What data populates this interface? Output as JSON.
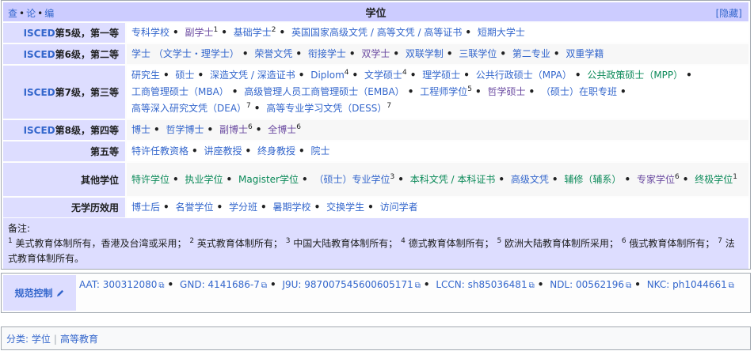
{
  "navbox": {
    "vde": [
      "查",
      "论",
      "编"
    ],
    "title": "学位",
    "hide_label": "[隐藏]",
    "rows": [
      {
        "group_prefix": "ISCED",
        "group_suffix": "第5级，第一等",
        "items": [
          {
            "text": "专科学校"
          },
          {
            "text": "副学士",
            "sup": "1"
          },
          {
            "text": "基础学士",
            "sup": "2"
          },
          {
            "text": "英国国家高级文凭 / 高等文凭 / 高等证书"
          },
          {
            "text": "短期大学士"
          }
        ]
      },
      {
        "group_prefix": "ISCED",
        "group_suffix": "第6级，第二等",
        "items": [
          {
            "text": "学士 （文学士・理学士）"
          },
          {
            "text": "荣誉文凭"
          },
          {
            "text": "衔接学士"
          },
          {
            "text": "双学士"
          },
          {
            "text": "双联学制"
          },
          {
            "text": "三联学位"
          },
          {
            "text": "第二专业"
          },
          {
            "text": "双重学籍"
          }
        ]
      },
      {
        "group_prefix": "ISCED",
        "group_suffix": "第7级，第三等",
        "items": [
          {
            "text": "研究生"
          },
          {
            "text": "硕士"
          },
          {
            "text": "深造文凭 / 深造证书"
          },
          {
            "text": "Diplom",
            "sup": "4"
          },
          {
            "text": "文学硕士",
            "sup": "4"
          },
          {
            "text": "理学硕士"
          },
          {
            "text": "公共行政硕士（MPA）"
          },
          {
            "text": "公共政策硕士（MPP）"
          },
          {
            "text": "工商管理硕士（MBA）"
          },
          {
            "text": "高级管理人员工商管理硕士（EMBA）"
          },
          {
            "text": "工程师学位",
            "sup": "5"
          },
          {
            "text": "哲学硕士"
          },
          {
            "text": "（硕士）在职专班"
          },
          {
            "text": "高等深入研究文凭（DEA）",
            "sup": "7"
          },
          {
            "text": "高等专业学习文凭（DESS）",
            "sup": "7"
          }
        ]
      },
      {
        "group_prefix": "ISCED",
        "group_suffix": "第8级，第四等",
        "items": [
          {
            "text": "博士"
          },
          {
            "text": "哲学博士"
          },
          {
            "text": "副博士",
            "sup": "6"
          },
          {
            "text": "全博士",
            "sup": "6"
          }
        ]
      },
      {
        "group_prefix": "",
        "group_suffix": "第五等",
        "items": [
          {
            "text": "特许任教资格"
          },
          {
            "text": "讲座教授"
          },
          {
            "text": "终身教授"
          },
          {
            "text": "院士"
          }
        ]
      },
      {
        "group_prefix": "",
        "group_suffix": "其他学位",
        "items": [
          {
            "text": "特许学位"
          },
          {
            "text": "执业学位"
          },
          {
            "text": "Magister学位"
          },
          {
            "text": "（硕士）专业学位",
            "sup": "3"
          },
          {
            "text": "本科文凭 / 本科证书"
          },
          {
            "text": "高级文凭"
          },
          {
            "text": "辅修（辅系）"
          },
          {
            "text": "专家学位",
            "sup": "6"
          },
          {
            "text": "终极学位",
            "sup": "1"
          }
        ]
      },
      {
        "group_prefix": "",
        "group_suffix": "无学历效用",
        "items": [
          {
            "text": "博士后"
          },
          {
            "text": "名誉学位"
          },
          {
            "text": "学分班"
          },
          {
            "text": "暑期学校"
          },
          {
            "text": "交换学生"
          },
          {
            "text": "访问学者"
          }
        ]
      }
    ],
    "note": {
      "label": "备注:",
      "lines": [
        {
          "sup": "1",
          "text": "美式教育体制所有，香港及台湾或采用；"
        },
        {
          "sup": "2",
          "text": "英式教育体制所有；"
        },
        {
          "sup": "3",
          "text": "中国大陆教育体制所有；"
        },
        {
          "sup": "4",
          "text": "德式教育体制所有；"
        },
        {
          "sup": "5",
          "text": "欧洲大陆教育体制所采用；"
        },
        {
          "sup": "6",
          "text": "俄式教育体制所有；"
        },
        {
          "sup": "7",
          "text": "法式教育体制所有。"
        }
      ]
    }
  },
  "authority": {
    "label": "规范控制",
    "items": [
      "AAT: 300312080",
      "GND: 4141686-7",
      "J9U: 987007545600605171",
      "LCCN: sh85036481",
      "NDL: 00562196",
      "NKC: ph1044661"
    ]
  },
  "categories": {
    "label": "分类:",
    "items": [
      "学位",
      "高等教育"
    ]
  },
  "colors": {
    "link": "#3366cc",
    "visited": "#6b4ba1",
    "title_bg": "#ccccff",
    "group_bg": "#ddddff"
  }
}
